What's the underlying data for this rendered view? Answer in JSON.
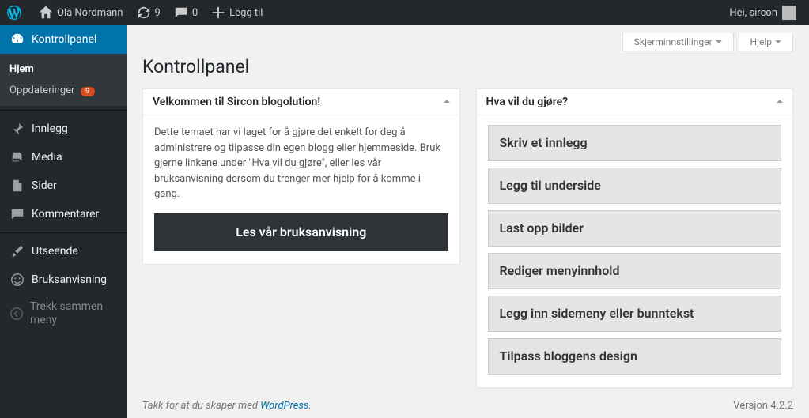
{
  "adminbar": {
    "site_name": "Ola Nordmann",
    "updates": "9",
    "comments": "0",
    "add_new": "Legg til",
    "greeting": "Hei, sircon"
  },
  "sidebar": {
    "dashboard": "Kontrollpanel",
    "home": "Hjem",
    "updates": "Oppdateringer",
    "updates_count": "9",
    "posts": "Innlegg",
    "media": "Media",
    "pages": "Sider",
    "comments": "Kommentarer",
    "appearance": "Utseende",
    "manual": "Bruksanvisning",
    "collapse": "Trekk sammen meny"
  },
  "screen": {
    "options": "Skjerminnstillinger",
    "help": "Hjelp"
  },
  "page_title": "Kontrollpanel",
  "welcome_box": {
    "title": "Velkommen til Sircon blogolution!",
    "body": "Dette temaet har vi laget for å gjøre det enkelt for deg å administrere og tilpasse din egen blogg eller hjemmeside. Bruk gjerne linkene under \"Hva vil du gjøre\", eller les vår bruksanvisning dersom du trenger mer hjelp for å komme i gang.",
    "button": "Les vår bruksanvisning"
  },
  "actions_box": {
    "title": "Hva vil du gjøre?",
    "items": [
      "Skriv et innlegg",
      "Legg til underside",
      "Last opp bilder",
      "Rediger menyinnhold",
      "Legg inn sidemeny eller bunntekst",
      "Tilpass bloggens design"
    ]
  },
  "footer": {
    "thanks_prefix": "Takk for at du skaper med ",
    "wp": "WordPress",
    "period": ".",
    "version": "Versjon 4.2.2"
  }
}
